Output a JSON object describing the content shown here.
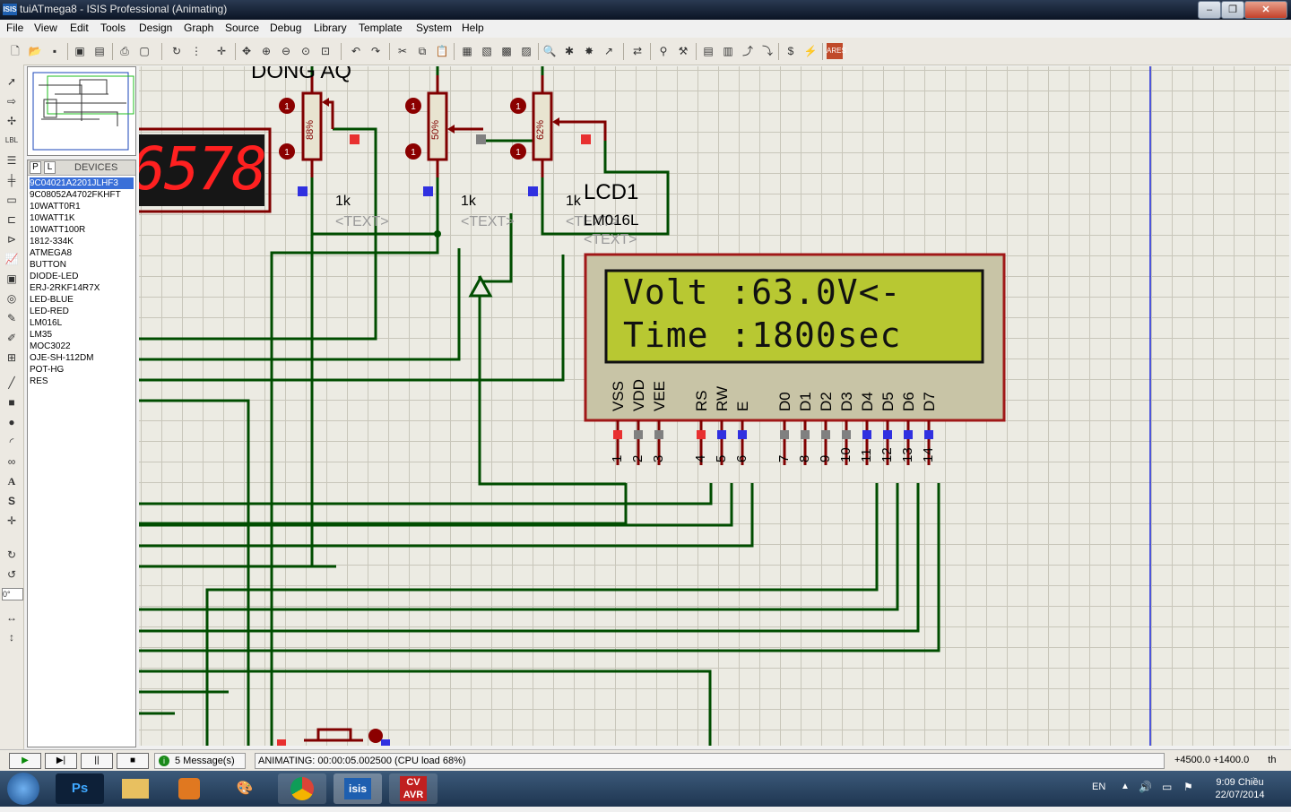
{
  "window": {
    "title": "tuiATmega8 - ISIS Professional (Animating)",
    "app_icon": "ISIS"
  },
  "menu": [
    "File",
    "View",
    "Edit",
    "Tools",
    "Design",
    "Graph",
    "Source",
    "Debug",
    "Library",
    "Template",
    "System",
    "Help"
  ],
  "devices_pane": {
    "tab_p": "P",
    "tab_l": "L",
    "header": "DEVICES",
    "items": [
      "9C04021A2201JLHF3",
      "9C08052A4702FKHFT",
      "10WATT0R1",
      "10WATT1K",
      "10WATT100R",
      "1812-334K",
      "ATMEGA8",
      "BUTTON",
      "DIODE-LED",
      "ERJ-2RKF14R7X",
      "LED-BLUE",
      "LED-RED",
      "LM016L",
      "LM35",
      "MOC3022",
      "OJE-SH-112DM",
      "POT-HG",
      "RES"
    ],
    "selected": 0
  },
  "rotation_field": "0°",
  "schematic": {
    "heading": "DONG AQ",
    "display_digits": "6578",
    "pots": [
      {
        "percent": "88%",
        "value": "1k",
        "text": "<TEXT>"
      },
      {
        "percent": "50%",
        "value": "1k",
        "text": "<TEXT>"
      },
      {
        "percent": "62%",
        "value": "1k",
        "text": "<TEXT>"
      }
    ],
    "lcd": {
      "ref": "LCD1",
      "part": "LM016L",
      "text": "<TEXT>",
      "line1": "Volt :63.0V<-",
      "line2": "Time :1800sec",
      "pins": [
        "VSS",
        "VDD",
        "VEE",
        "RS",
        "RW",
        "E",
        "D0",
        "D1",
        "D2",
        "D3",
        "D4",
        "D5",
        "D6",
        "D7"
      ],
      "pin_numbers": [
        "1",
        "2",
        "3",
        "4",
        "5",
        "6",
        "7",
        "8",
        "9",
        "10",
        "11",
        "12",
        "13",
        "14"
      ],
      "pin_colors": [
        "red",
        "gray",
        "gray",
        "red",
        "blue",
        "blue",
        "gray",
        "gray",
        "gray",
        "gray",
        "blue",
        "blue",
        "blue",
        "blue"
      ],
      "screen_color": "#b8c832"
    },
    "wire_color": "#004d00",
    "component_color": "#800000"
  },
  "statusbar": {
    "messages": "5 Message(s)",
    "animating": "ANIMATING: 00:00:05.002500 (CPU load 68%)",
    "coord_x": "+4500.0",
    "coord_y": "+1400.0",
    "unit": "th"
  },
  "taskbar": {
    "language": "EN",
    "time": "9:09 Chiều",
    "date": "22/07/2014",
    "apps": [
      "Photoshop",
      "File Explorer",
      "Media Player",
      "Paint",
      "Chrome",
      "ISIS",
      "CVAVR"
    ]
  }
}
